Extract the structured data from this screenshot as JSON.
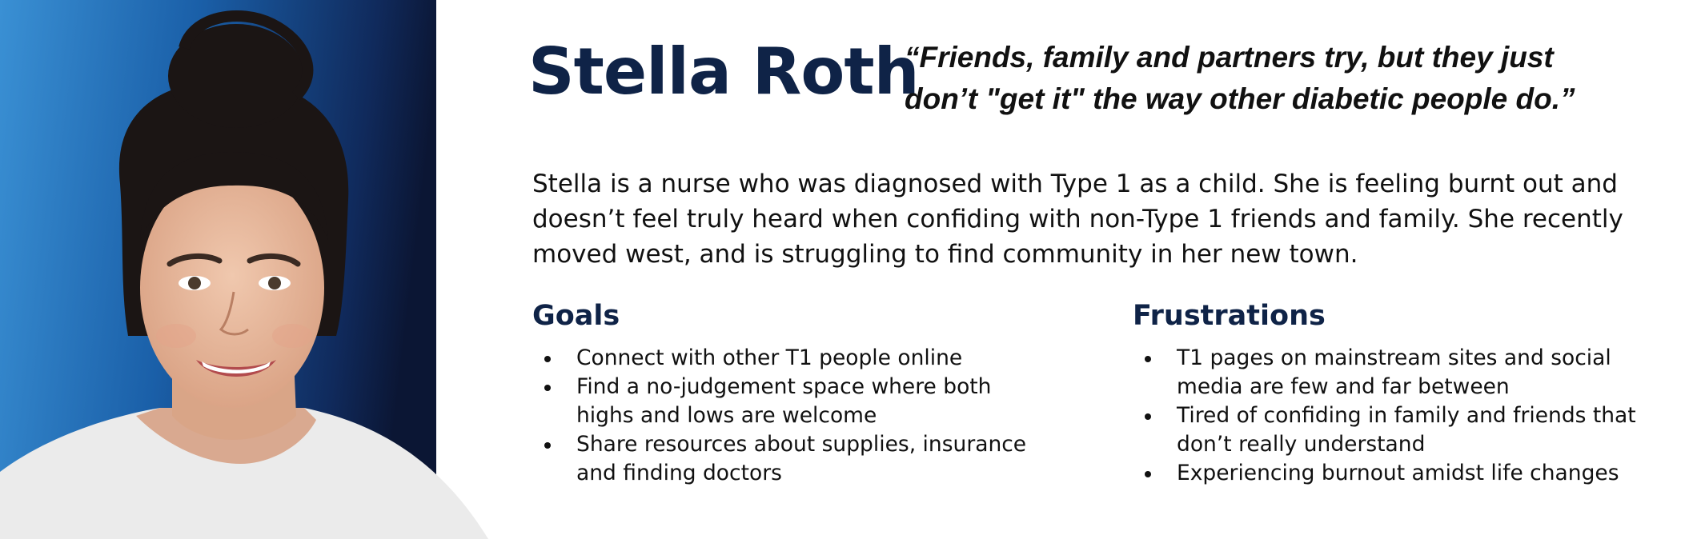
{
  "persona": {
    "name": "Stella Roth",
    "quote_lines": [
      "“Friends, family and partners try, but they just",
      "don’t \"get it\" the way other diabetic people do.”"
    ],
    "bio_lines": [
      "Stella is a nurse who was diagnosed with Type 1 as a child.  She is feeling burnt out and",
      "doesn’t feel truly heard when confiding with non-Type 1 friends and family. She recently",
      "moved west, and is struggling to find community in her new town."
    ]
  },
  "goals": {
    "title": "Goals",
    "items": [
      {
        "lines": [
          "Connect with other T1 people online"
        ]
      },
      {
        "lines": [
          "Find a no-judgement space where both",
          "highs and lows are welcome"
        ]
      },
      {
        "lines": [
          "Share resources about supplies, insurance",
          "and finding doctors"
        ]
      }
    ]
  },
  "frustrations": {
    "title": "Frustrations",
    "items": [
      {
        "lines": [
          "T1 pages on mainstream sites and social",
          "media are few and far between"
        ]
      },
      {
        "lines": [
          "Tired of confiding in family and friends that",
          "don’t really understand"
        ]
      },
      {
        "lines": [
          "Experiencing burnout amidst life changes"
        ]
      }
    ]
  },
  "colors": {
    "heading_navy": "#0f2347",
    "photo_background_light": "#3a8fd2",
    "photo_background_dark": "#0c1a3a"
  }
}
